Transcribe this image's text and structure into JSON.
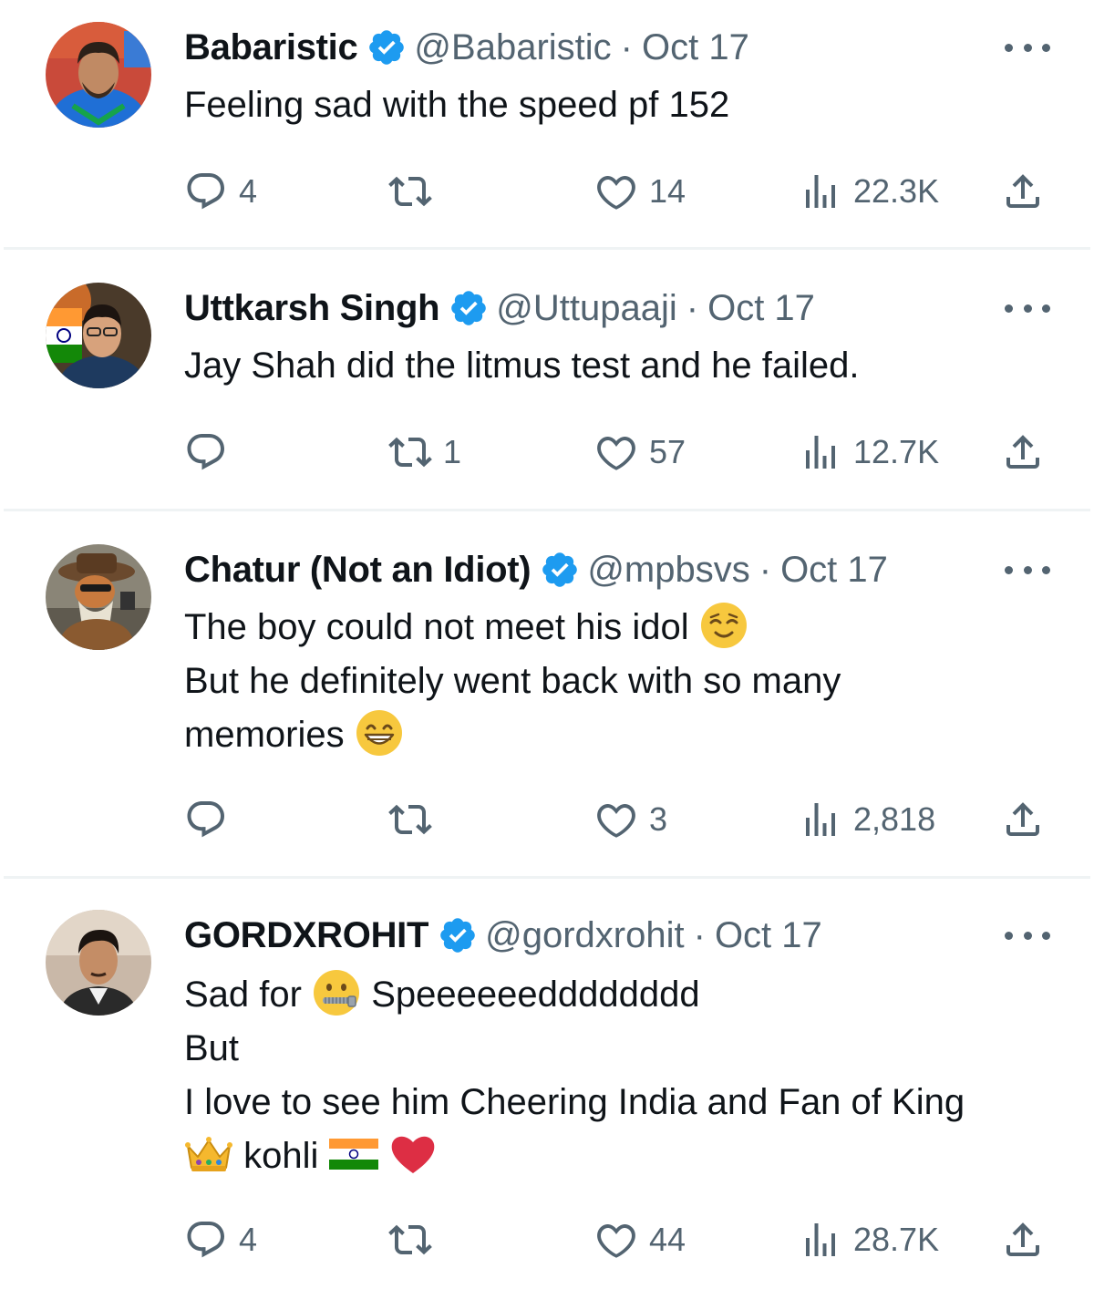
{
  "tweets": [
    {
      "name": "Babaristic",
      "handle": "@Babaristic",
      "separator": "·",
      "date": "Oct 17",
      "lines": [
        "Feeling sad with the speed pf 152"
      ],
      "replies": "4",
      "retweets": "",
      "likes": "14",
      "views": "22.3K"
    },
    {
      "name": "Uttkarsh Singh",
      "handle": "@Uttupaaji",
      "separator": "·",
      "date": "Oct 17",
      "lines": [
        "Jay Shah did the litmus test and he failed."
      ],
      "replies": "",
      "retweets": "1",
      "likes": "57",
      "views": "12.7K"
    },
    {
      "name": "Chatur (Not an Idiot)",
      "handle": "@mpbsvs",
      "separator": "·",
      "date": "Oct 17",
      "lines": [
        "The boy could not meet his idol",
        "But he definitely went back with so many",
        "memories"
      ],
      "replies": "",
      "retweets": "",
      "likes": "3",
      "views": "2,818"
    },
    {
      "name": "GORDXROHIT",
      "handle": "@gordxrohit",
      "separator": "·",
      "date": "Oct 17",
      "lines": [
        "Sad for",
        "Speeeeeedddddddd",
        "But",
        "I love to see him Cheering India and Fan of  King",
        "kohli"
      ],
      "replies": "4",
      "retweets": "",
      "likes": "44",
      "views": "28.7K"
    }
  ],
  "colors": {
    "verified_blue": "#1d9bf0",
    "secondary_text": "#536471",
    "divider": "#eff3f4"
  },
  "icons": [
    "verified-badge-icon",
    "more-icon",
    "reply-icon",
    "retweet-icon",
    "like-icon",
    "views-icon",
    "share-icon",
    "relieved-face-emoji",
    "grinning-face-emoji",
    "zipper-mouth-face-emoji",
    "crown-emoji",
    "india-flag-emoji",
    "red-heart-emoji"
  ]
}
